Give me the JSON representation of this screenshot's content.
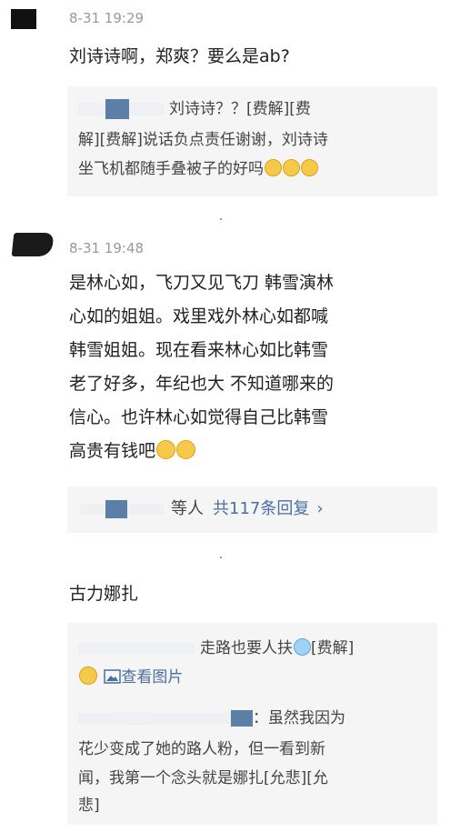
{
  "comment1": {
    "time": "8-31 19:29",
    "text": "刘诗诗啊，郑爽？要么是ab?",
    "quote": {
      "line1_tail": "刘诗诗？？[费解][费",
      "line2": "解][费解]说话负点责任谢谢，刘诗诗",
      "line3": "坐飞机都随手叠被子的好吗"
    }
  },
  "comment2": {
    "time": "8-31 19:48",
    "lines": [
      "是林心如，飞刀又见飞刀 韩雪演林",
      "心如的姐姐。戏里戏外林心如都喊",
      "韩雪姐姐。现在看来林心如比韩雪",
      "老了好多，年纪也大 不知道哪来的",
      "信心。也许林心如觉得自己比韩雪",
      "高贵有钱吧"
    ],
    "replies_prefix": "等人",
    "replies_link": "共117条回复",
    "replies_chevron": "›"
  },
  "comment3": {
    "text": "古力娜扎",
    "quote1": {
      "line1_tail": "走路也要人扶",
      "line1_suffix": "[费解]",
      "view_image": "查看图片"
    },
    "quote2": {
      "line1_tail": "：虽然我因为",
      "line2": "花少变成了她的路人粉，但一看到新",
      "line3": "闻，我第一个念头就是娜扎[允悲][允",
      "line4": "悲]"
    }
  },
  "colors": {
    "link": "#4a6fa0",
    "quote_bg": "#f5f5f5",
    "time": "#999999"
  }
}
